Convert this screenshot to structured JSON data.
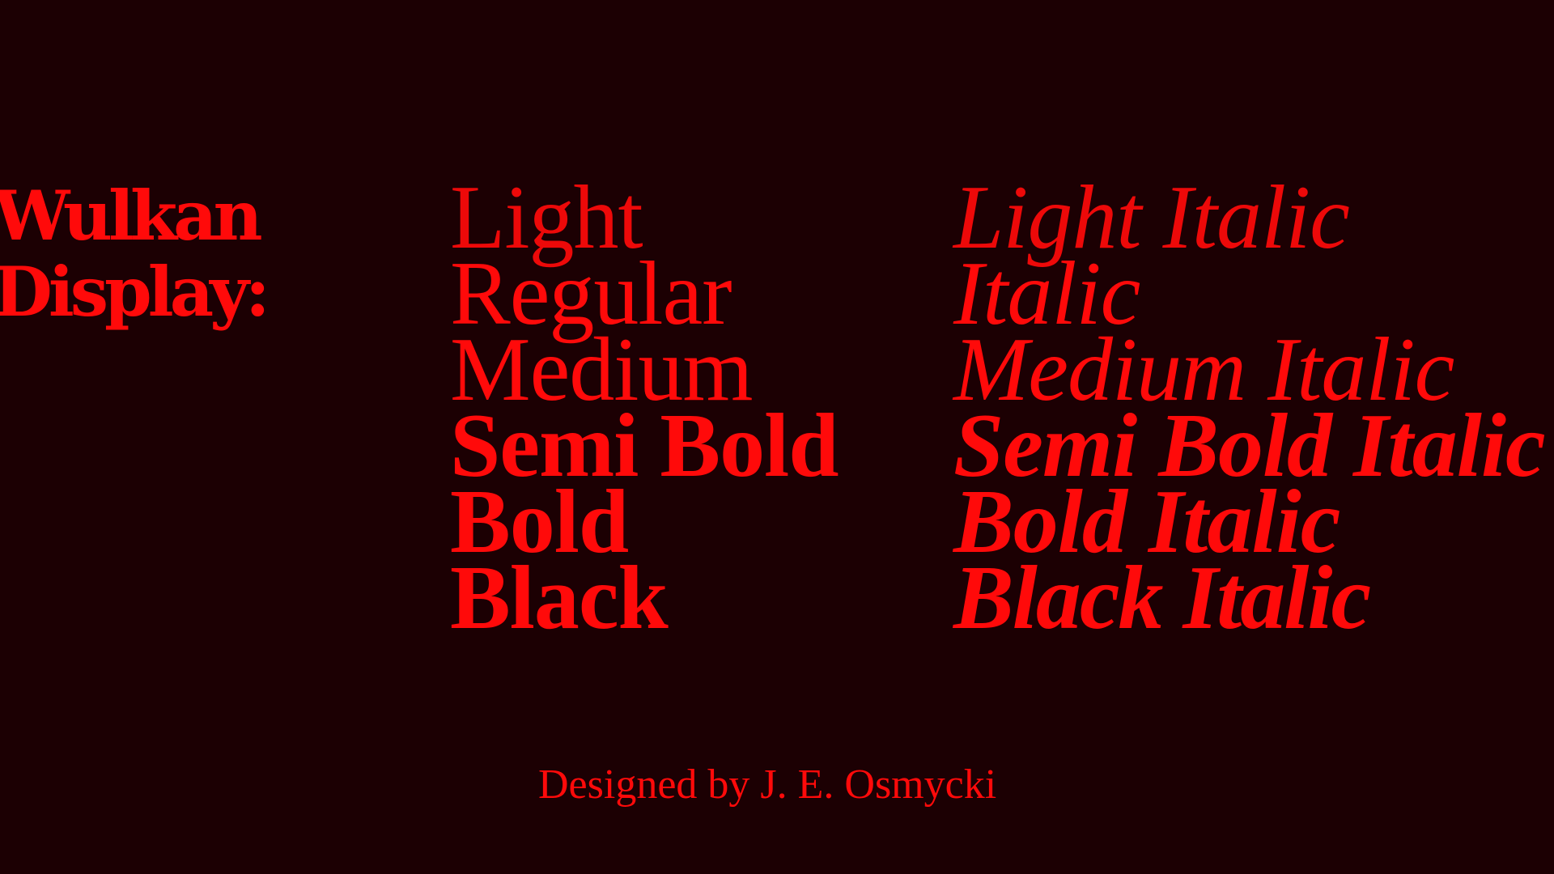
{
  "title": {
    "line1": "Wulkan",
    "line2": "Display:"
  },
  "roman_styles": [
    {
      "label": "Light",
      "weight": "light"
    },
    {
      "label": "Regular",
      "weight": "regular"
    },
    {
      "label": "Medium",
      "weight": "medium"
    },
    {
      "label": "Semi Bold",
      "weight": "semibold"
    },
    {
      "label": "Bold",
      "weight": "bold"
    },
    {
      "label": "Black",
      "weight": "black"
    }
  ],
  "italic_styles": [
    {
      "label": "Light Italic",
      "weight": "light"
    },
    {
      "label": "Italic",
      "weight": "regular"
    },
    {
      "label": "Medium Italic",
      "weight": "medium"
    },
    {
      "label": "Semi Bold Italic",
      "weight": "semibold"
    },
    {
      "label": "Bold Italic",
      "weight": "bold"
    },
    {
      "label": "Black Italic",
      "weight": "black"
    }
  ],
  "credit": "Designed by J. E. Osmycki",
  "colors": {
    "background": "#1c0003",
    "text": "#ff0a0a"
  }
}
